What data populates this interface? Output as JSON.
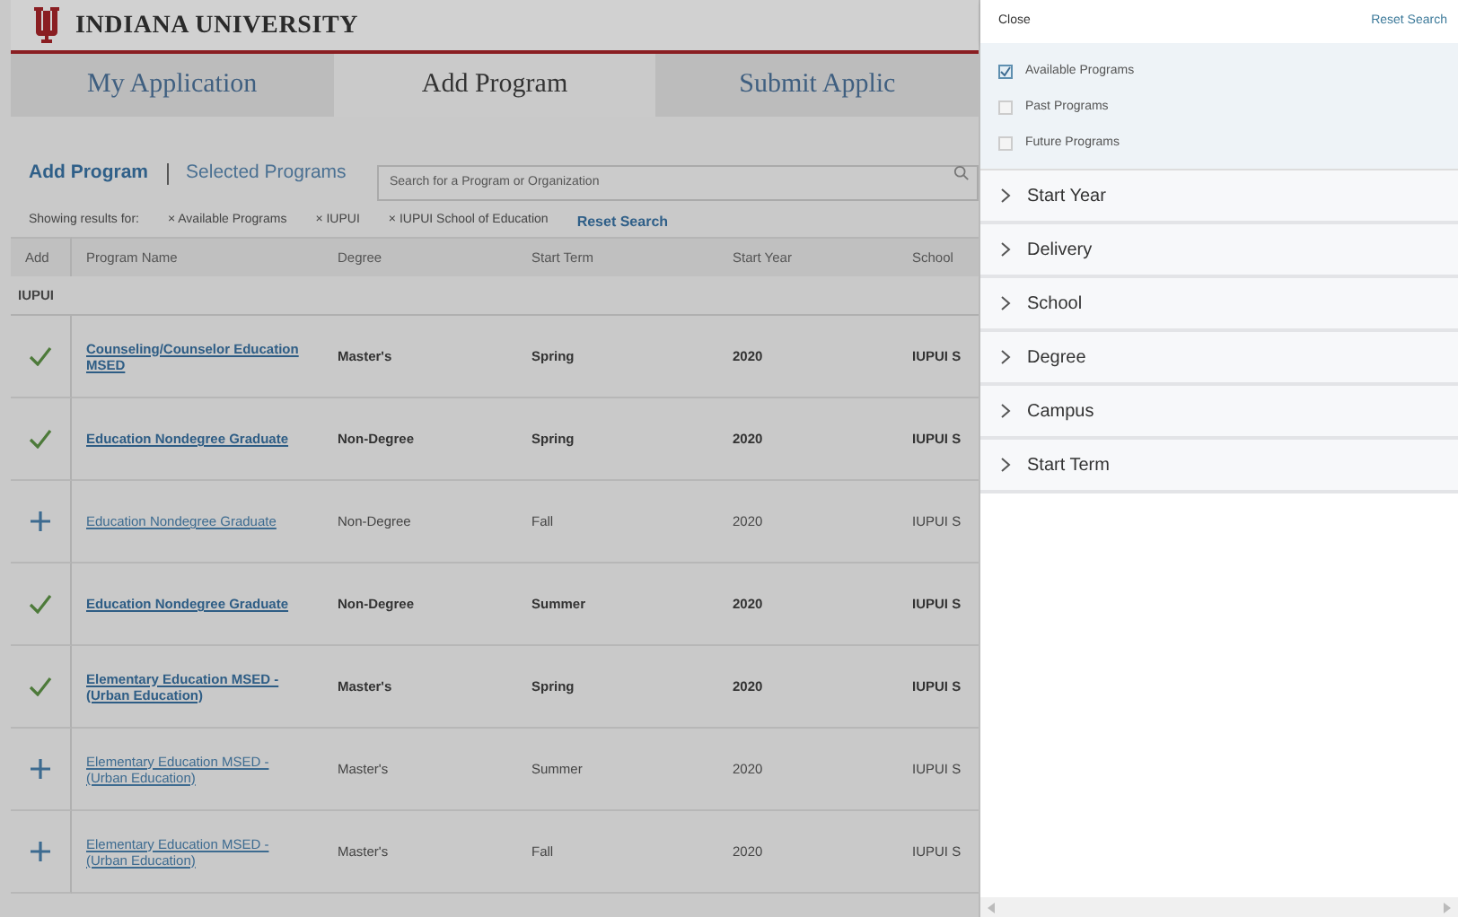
{
  "header": {
    "title": "INDIANA UNIVERSITY"
  },
  "tabs": [
    {
      "label": "My Application",
      "selected": false
    },
    {
      "label": "Add Program",
      "selected": true
    },
    {
      "label": "Submit Applic",
      "selected": false
    }
  ],
  "subnav": [
    {
      "label": "Add Program",
      "selected": true
    },
    {
      "label": "Selected Programs",
      "selected": false
    }
  ],
  "search": {
    "placeholder": "Search for a Program or Organization"
  },
  "filters": {
    "label": "Showing results for:",
    "chips": [
      "× Available Programs",
      "× IUPUI",
      "× IUPUI School of Education"
    ],
    "reset": "Reset Search"
  },
  "table": {
    "columns": [
      "Add",
      "Program Name",
      "Degree",
      "Start Term",
      "Start Year",
      "School"
    ],
    "group": "IUPUI",
    "rows": [
      {
        "added": true,
        "name": "Counseling/Counselor Education MSED",
        "degree": "Master's",
        "term": "Spring",
        "year": "2020",
        "school": "IUPUI S"
      },
      {
        "added": true,
        "name": "Education Nondegree Graduate",
        "degree": "Non-Degree",
        "term": "Spring",
        "year": "2020",
        "school": "IUPUI S"
      },
      {
        "added": false,
        "name": "Education Nondegree Graduate",
        "degree": "Non-Degree",
        "term": "Fall",
        "year": "2020",
        "school": "IUPUI S"
      },
      {
        "added": true,
        "name": "Education Nondegree Graduate",
        "degree": "Non-Degree",
        "term": "Summer",
        "year": "2020",
        "school": "IUPUI S"
      },
      {
        "added": true,
        "name": "Elementary Education MSED - (Urban Education)",
        "degree": "Master's",
        "term": "Spring",
        "year": "2020",
        "school": "IUPUI S"
      },
      {
        "added": false,
        "name": "Elementary Education MSED - (Urban Education)",
        "degree": "Master's",
        "term": "Summer",
        "year": "2020",
        "school": "IUPUI S"
      },
      {
        "added": false,
        "name": "Elementary Education MSED - (Urban Education)",
        "degree": "Master's",
        "term": "Fall",
        "year": "2020",
        "school": "IUPUI S"
      }
    ]
  },
  "panel": {
    "close": "Close",
    "reset": "Reset Search",
    "options": [
      {
        "label": "Available Programs",
        "checked": true
      },
      {
        "label": "Past Programs",
        "checked": false
      },
      {
        "label": "Future Programs",
        "checked": false
      }
    ],
    "sections": [
      {
        "label": "Start Year",
        "expanded": false
      },
      {
        "label": "Delivery",
        "expanded": false
      },
      {
        "label": "School",
        "expanded": false
      },
      {
        "label": "Degree",
        "expanded": false
      },
      {
        "label": "Campus",
        "expanded": false
      },
      {
        "label": "Start Term",
        "expanded": false
      }
    ]
  }
}
